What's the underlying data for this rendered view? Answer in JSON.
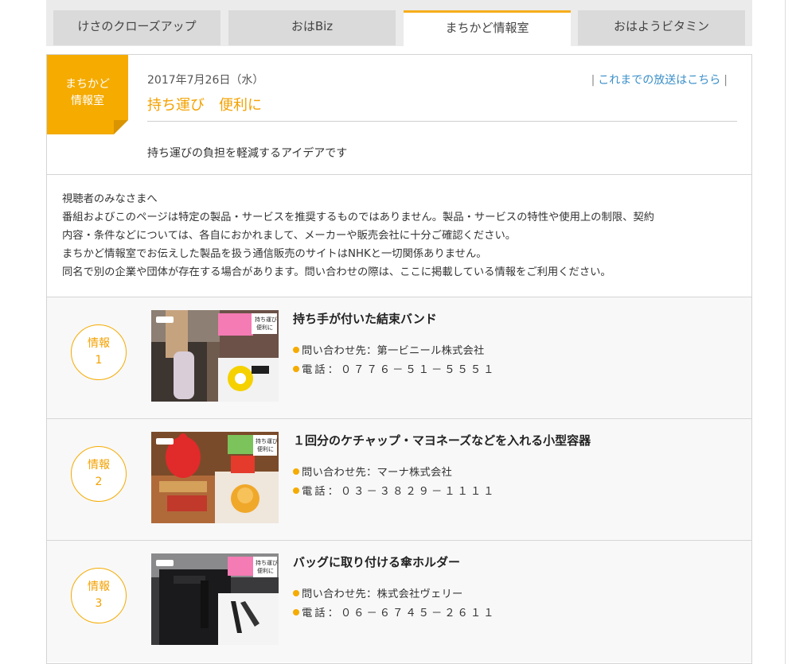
{
  "tabs": [
    {
      "label": "けさのクローズアップ",
      "active": false
    },
    {
      "label": "おはBiz",
      "active": false
    },
    {
      "label": "まちかど情報室",
      "active": true
    },
    {
      "label": "おはようビタミン",
      "active": false
    }
  ],
  "badge": {
    "line1": "まちかど",
    "line2": "情報室"
  },
  "episode": {
    "date": "2017年7月26日（水）",
    "title": "持ち運び　便利に",
    "summary": "持ち運びの負担を軽減するアイデアです"
  },
  "archive": {
    "sep_left": "|",
    "label": "これまでの放送はこちら",
    "sep_right": "|"
  },
  "notice": [
    "視聴者のみなさまへ",
    "番組およびこのページは特定の製品・サービスを推奨するものではありません。製品・サービスの特性や使用上の制限、契約",
    "内容・条件などについては、各自におかれまして、メーカーや販売会社に十分ご確認ください。",
    "まちかど情報室でお伝えした製品を扱う通信販売のサイトはNHKと一切関係ありません。",
    "同名で別の企業や団体が存在する場合があります。問い合わせの際は、ここに掲載している情報をご利用ください。"
  ],
  "items": [
    {
      "num_label": "情報",
      "num": "1",
      "title": "持ち手が付いた結束バンド",
      "contact": "問い合わせ先：第一ビニール株式会社",
      "phone": "電話：０７７６－５１－５５５１"
    },
    {
      "num_label": "情報",
      "num": "2",
      "title": "１回分のケチャップ・マヨネーズなどを入れる小型容器",
      "contact": "問い合わせ先：マーナ株式会社",
      "phone": "電話：０３－３８２９－１１１１"
    },
    {
      "num_label": "情報",
      "num": "3",
      "title": "バッグに取り付ける傘ホルダー",
      "contact": "問い合わせ先：株式会社ヴェリー",
      "phone": "電話：０６－６７４５－２６１１"
    }
  ],
  "thumb_caption": "持ち運び\n便利に",
  "colors": {
    "accent": "#f5ab00",
    "link": "#3a8fc8"
  }
}
